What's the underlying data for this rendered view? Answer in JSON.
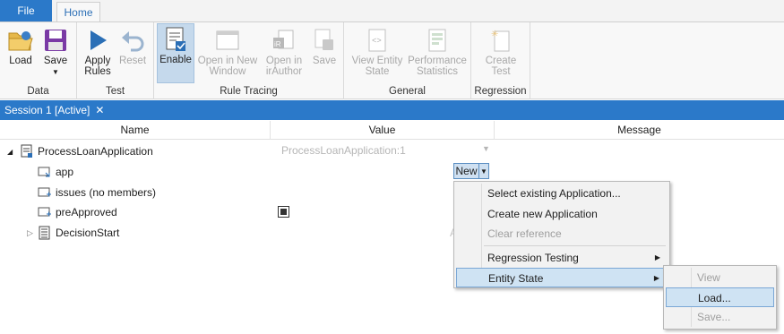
{
  "tabs": {
    "file": "File",
    "home": "Home"
  },
  "ribbon": {
    "data": {
      "label": "Data",
      "load": "Load",
      "save": "Save"
    },
    "test": {
      "label": "Test",
      "apply_line1": "Apply",
      "apply_line2": "Rules",
      "reset": "Reset"
    },
    "rule_tracing": {
      "label": "Rule Tracing",
      "enable": "Enable",
      "open_new_1": "Open in New",
      "open_new_2": "Window",
      "open_ir_1": "Open in",
      "open_ir_2": "irAuthor",
      "save": "Save"
    },
    "general": {
      "label": "General",
      "ves_1": "View Entity",
      "ves_2": "State",
      "perf_1": "Performance",
      "perf_2": "Statistics"
    },
    "regression": {
      "label": "Regression",
      "create_1": "Create",
      "create_2": "Test"
    }
  },
  "session": {
    "tab_label": "Session 1 [Active]",
    "close": "✕"
  },
  "columns": {
    "name": "Name",
    "value": "Value",
    "message": "Message"
  },
  "tree": {
    "root": {
      "label": "ProcessLoanApplication",
      "value": "ProcessLoanApplication:1"
    },
    "children": [
      {
        "label": "app",
        "value": "New"
      },
      {
        "label": "issues (no members)"
      },
      {
        "label": "preApproved",
        "checked": true
      },
      {
        "label": "DecisionStart",
        "value_partial": "A"
      }
    ]
  },
  "menu": {
    "items": [
      "Select existing Application...",
      "Create new Application",
      "Clear reference",
      "Regression Testing",
      "Entity State"
    ],
    "disabled": [
      "Clear reference"
    ],
    "highlighted": "Entity State"
  },
  "submenu": {
    "items": [
      "View",
      "Load...",
      "Save..."
    ],
    "disabled": [
      "View",
      "Save..."
    ],
    "highlighted": "Load..."
  },
  "colors": {
    "accent": "#2b79c9",
    "highlight": "#cfe3f3"
  }
}
